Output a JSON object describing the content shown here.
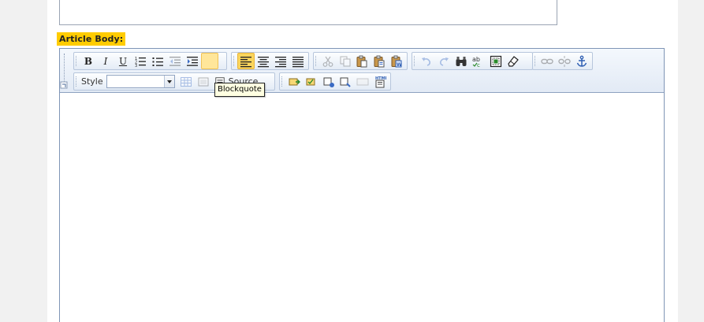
{
  "field": {
    "label": "Article Body:"
  },
  "toolbar": {
    "row1": {
      "group1": [
        {
          "name": "bold-button",
          "icon": "bold-icon",
          "text": "B",
          "cls": "txt-b"
        },
        {
          "name": "italic-button",
          "icon": "italic-icon",
          "text": "I",
          "cls": "txt-i"
        },
        {
          "name": "underline-button",
          "icon": "underline-icon",
          "text": "U",
          "cls": "txt-u"
        }
      ]
    },
    "row2": {
      "style_label": "Style",
      "style_value": "",
      "source_label": "Source"
    }
  },
  "tooltip": {
    "text": "Blockquote"
  },
  "colors": {
    "accent": "#ffcc00",
    "toolbar_border": "#b7c6dc",
    "active_button": "#fbd55c",
    "tooltip_bg": "#ffffe1"
  }
}
